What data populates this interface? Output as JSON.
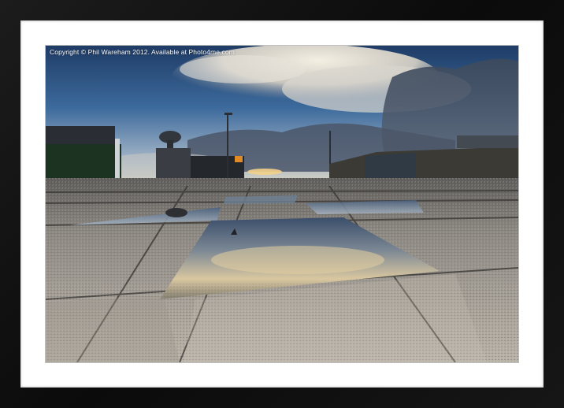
{
  "photo": {
    "watermark": "Copyright © Phil Wareham 2012. Available at Photo4me.com"
  },
  "colors": {
    "frame": "#111111",
    "mount": "#ffffff",
    "sky_top": "#27456f",
    "sky_horizon": "#9fb3c8",
    "paving": "#a7a19a"
  }
}
